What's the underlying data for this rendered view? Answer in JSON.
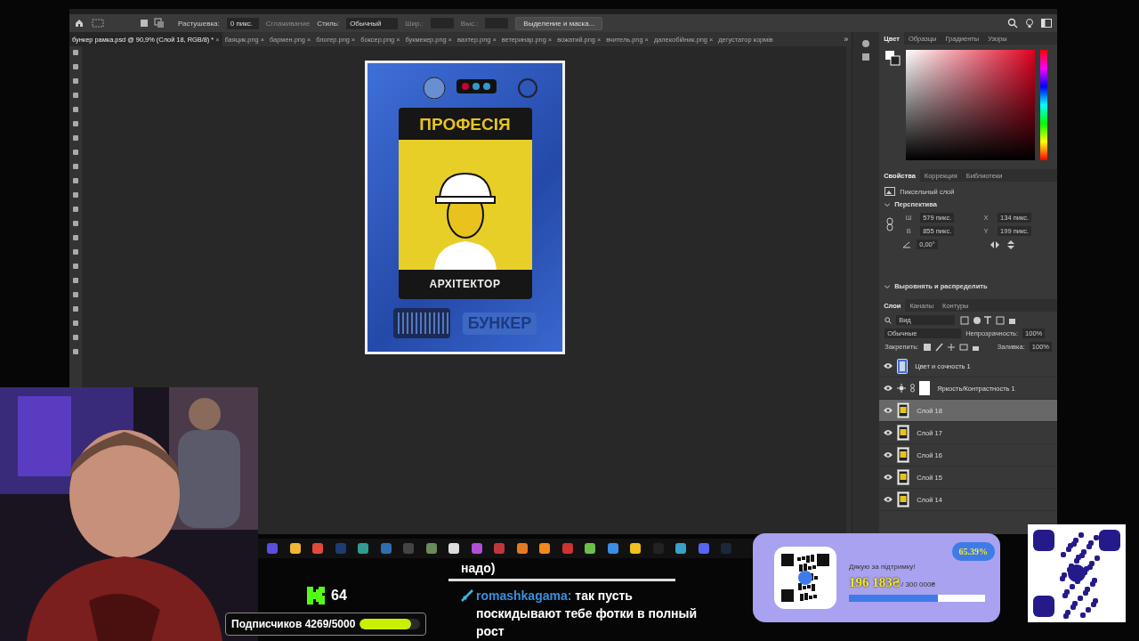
{
  "options_bar": {
    "feather_label": "Растушевка:",
    "feather_value": "0 пикс.",
    "smoothing": {
      "label": "Сглаживание",
      "disabled": true
    },
    "style_label": "Стиль:",
    "style_value": "Обычный",
    "width": {
      "label": "Шир.:",
      "disabled": true
    },
    "height": {
      "label": "Выс.:",
      "disabled": true
    },
    "mask_button": "Выделение и маска..."
  },
  "doc_tabs": [
    {
      "label": "бункер рамка.psd @ 90,9% (Слой 18, RGB/8) *",
      "close": "×",
      "selected": true
    },
    {
      "label": "баяцик.png",
      "close": "×",
      "selected": false
    },
    {
      "label": "бармен.png",
      "close": "×",
      "selected": false
    },
    {
      "label": "блогер.png",
      "close": "×",
      "selected": false
    },
    {
      "label": "боксер.png",
      "close": "×",
      "selected": false
    },
    {
      "label": "букмекер.png",
      "close": "×",
      "selected": false
    },
    {
      "label": "вахтер.png",
      "close": "×",
      "selected": false
    },
    {
      "label": "ветеринар.png",
      "close": "×",
      "selected": false
    },
    {
      "label": "вожатий.png",
      "close": "×",
      "selected": false
    },
    {
      "label": "вчитель.png",
      "close": "×",
      "selected": false
    },
    {
      "label": "далекобійник.png",
      "close": "×",
      "selected": false
    },
    {
      "label": "дегустатор кормів",
      "selected": false
    }
  ],
  "tabs_overflow": "»",
  "document": {
    "title": "ПРОФЕСІЯ",
    "profession": "АРХІТЕКТОР",
    "brand": "БУНКЕР"
  },
  "color_tabs": [
    {
      "label": "Цвет",
      "selected": true
    },
    {
      "label": "Образцы",
      "selected": false
    },
    {
      "label": "Градиенты",
      "selected": false
    },
    {
      "label": "Узоры",
      "selected": false
    }
  ],
  "properties": {
    "tabs": [
      {
        "label": "Свойства",
        "selected": true
      },
      {
        "label": "Коррекция",
        "selected": false
      },
      {
        "label": "Библиотеки",
        "selected": false
      }
    ],
    "layer_type": "Пиксельный слой",
    "section": {
      "label": "Перспектива",
      "expanded": true
    },
    "fields": [
      {
        "label": "Ш",
        "value": "579 пикс."
      },
      {
        "label": "X",
        "value": "134 пикс."
      },
      {
        "label": "В",
        "value": "855 пикс."
      },
      {
        "label": "Y",
        "value": "199 пикс."
      }
    ],
    "angle": "0,00°",
    "section_2": {
      "label": "Выровнять и распределить"
    }
  },
  "layers": {
    "tabs": [
      {
        "label": "Слои",
        "selected": true
      },
      {
        "label": "Каналы",
        "selected": false
      },
      {
        "label": "Контуры",
        "selected": false
      }
    ],
    "filter": "Вид",
    "blend": "Обычные",
    "opacity_label": "Непрозрачность:",
    "opacity": "100%",
    "lock_label": "Закрепить:",
    "fill_label": "Заливка:",
    "fill": "100%",
    "items": [
      {
        "name": "Цвет и сочность 1",
        "kind": "hue",
        "visible": true,
        "selected": false
      },
      {
        "name": "Яркость/Контрастность 1",
        "kind": "brightness",
        "visible": true,
        "selected": false
      },
      {
        "name": "Слой 18",
        "kind": "pixel",
        "visible": true,
        "selected": true
      },
      {
        "name": "Слой 17",
        "kind": "pixel",
        "visible": true,
        "selected": false
      },
      {
        "name": "Слой 16",
        "kind": "pixel",
        "visible": true,
        "selected": false
      },
      {
        "name": "Слой 15",
        "kind": "pixel",
        "visible": true,
        "selected": false
      },
      {
        "name": "Слой 14",
        "kind": "pixel",
        "visible": true,
        "selected": false
      }
    ]
  },
  "stream": {
    "kick_count": "64",
    "subs_label": "Подписчиков 4269/5000",
    "subs": {
      "level": 0.854
    },
    "chat": [
      {
        "text": "надо)"
      },
      {
        "user": "romashkagama:",
        "text": "так пусть поскидывают тебе фотки в полный рост"
      }
    ],
    "donation": {
      "thanks": "Дякую за підтримку!",
      "raised": "196 183₴",
      "goal": "/ 300 000₴",
      "percent": "65.39%",
      "level": 0.654
    }
  }
}
